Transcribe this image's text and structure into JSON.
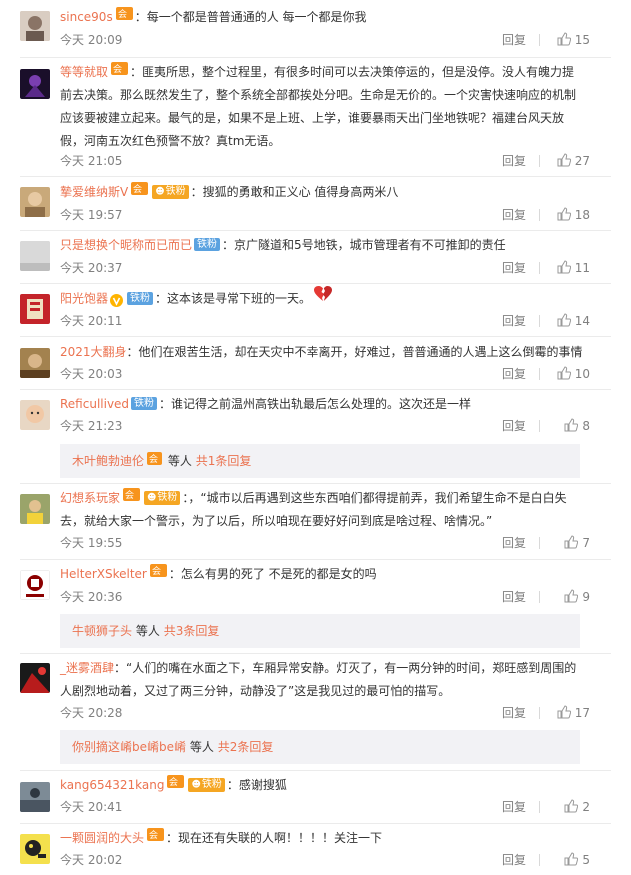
{
  "reply_label": "回复",
  "subreply_prefix": "等人",
  "comments": [
    {
      "user": "since90s",
      "text": "：每一个都是普普通通的人 每一个都是你我",
      "time": "今天 20:09",
      "likes": "15"
    },
    {
      "user": "等等就取",
      "text": "：匪夷所思，整个过程里，有很多时间可以去决策停运的，但是没停。没人有魄力提前去决策。那么既然发生了，整个系统全部都挨处分吧。生命是无价的。一个灾害快速响应的机制应该要被建立起来。最气的是，如果不是上班、上学，谁要暴雨天出门坐地铁呢？福建台风天放假，河南五次红色预警不放？真tm无语。",
      "time": "今天 21:05",
      "likes": "27"
    },
    {
      "user": "摯爱维纳斯V",
      "fan": "铁粉",
      "text": "：搜狐的勇敢和正义心 值得身高两米八",
      "time": "今天 19:57",
      "likes": "18"
    },
    {
      "user": "只是想换个昵称而已而已",
      "fan": "铁粉",
      "text": "：京广隧道和5号地铁，城市管理者有不可推卸的责任",
      "time": "今天 20:37",
      "likes": "11"
    },
    {
      "user": "阳光饱器",
      "fan": "铁粉",
      "text": "：这本该是寻常下班的一天。",
      "time": "今天 20:11",
      "likes": "14"
    },
    {
      "user": "2021大翻身",
      "text": "：他们在艰苦生活，却在天灾中不幸离开，好难过，普普通通的人遇上这么倒霉的事情",
      "time": "今天 20:03",
      "likes": "10"
    },
    {
      "user": "Reficullived",
      "fan": "铁粉",
      "text": "：谁记得之前温州高铁出轨最后怎么处理的。这次还是一样",
      "time": "今天 21:23",
      "likes": "8",
      "sub": {
        "name": "木叶鲍勃迪伦",
        "count": "共1条回复"
      }
    },
    {
      "user": "幻想系玩家",
      "fan": "铁粉",
      "text": "：，“城市以后再遇到这些东西咱们都得提前弄，我们希望生命不是白白失去，就给大家一个警示，为了以后，所以咱现在要好好问到底是啥过程、啥情况。”",
      "time": "今天 19:55",
      "likes": "7"
    },
    {
      "user": "HelterXSkelter",
      "text": "：怎么有男的死了 不是死的都是女的吗",
      "time": "今天 20:36",
      "likes": "9",
      "sub": {
        "name": "牛顿狮子头",
        "count": "共3条回复"
      }
    },
    {
      "user": "_迷雾酒肆",
      "text": "：“人们的嘴在水面之下，车厢异常安静。灯灭了，有一两分钟的时间，郑旺感到周围的人剧烈地动着，又过了两三分钟，动静没了”这是我见过的最可怕的描写。",
      "time": "今天 20:28",
      "likes": "17",
      "sub": {
        "name": "你别摘这崤be崤be崤",
        "count": "共2条回复"
      }
    },
    {
      "user": "kang654321kang",
      "fan": "铁粉",
      "text": "：感谢搜狐",
      "time": "今天 20:41",
      "likes": "2"
    },
    {
      "user": "一颗圆润的大头",
      "text": "：现在还有失联的人啊！！！！关注一下",
      "time": "今天 20:02",
      "likes": "5"
    }
  ]
}
